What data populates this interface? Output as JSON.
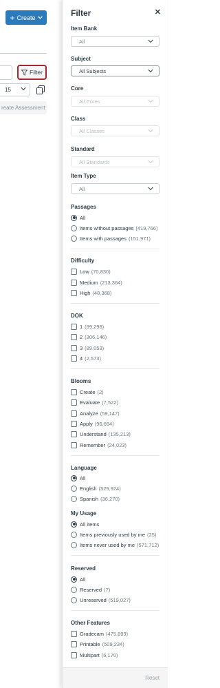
{
  "background": {
    "create_button": "Create",
    "filter_button": "Filter",
    "page_size_value": "15",
    "create_assessment": "reate Assessment"
  },
  "filter": {
    "title": "Filter",
    "item_bank": {
      "label": "Item Bank",
      "value": "All"
    },
    "subject": {
      "label": "Subject",
      "value": "All Subjects"
    },
    "core": {
      "label": "Core",
      "value": "All Cores"
    },
    "class": {
      "label": "Class",
      "value": "All Classes"
    },
    "standard": {
      "label": "Standard",
      "value": "All Standards"
    },
    "item_type": {
      "label": "Item Type",
      "value": "All"
    },
    "passages": {
      "label": "Passages",
      "options": [
        {
          "label": "All",
          "count": "",
          "selected": true
        },
        {
          "label": "Items without passages",
          "count": "(419,766)"
        },
        {
          "label": "Items with passages",
          "count": "(151,971)"
        }
      ]
    },
    "difficulty": {
      "label": "Difficulty",
      "options": [
        {
          "label": "Low",
          "count": "(70,830)"
        },
        {
          "label": "Medium",
          "count": "(213,364)"
        },
        {
          "label": "High",
          "count": "(48,368)"
        }
      ]
    },
    "dok": {
      "label": "DOK",
      "options": [
        {
          "label": "1",
          "count": "(99,298)"
        },
        {
          "label": "2",
          "count": "(306,146)"
        },
        {
          "label": "3",
          "count": "(89,053)"
        },
        {
          "label": "4",
          "count": "(2,573)"
        }
      ]
    },
    "blooms": {
      "label": "Blooms",
      "options": [
        {
          "label": "Create",
          "count": "(2)"
        },
        {
          "label": "Evaluate",
          "count": "(7,522)"
        },
        {
          "label": "Analyze",
          "count": "(59,147)"
        },
        {
          "label": "Apply",
          "count": "(96,694)"
        },
        {
          "label": "Understand",
          "count": "(135,213)"
        },
        {
          "label": "Remember",
          "count": "(24,023)"
        }
      ]
    },
    "language": {
      "label": "Language",
      "options": [
        {
          "label": "All",
          "count": "",
          "selected": true
        },
        {
          "label": "English",
          "count": "(529,924)"
        },
        {
          "label": "Spanish",
          "count": "(36,270)"
        }
      ]
    },
    "my_usage": {
      "label": "My Usage",
      "options": [
        {
          "label": "All items",
          "count": "",
          "selected": true
        },
        {
          "label": "Items previously used by me",
          "count": "(25)"
        },
        {
          "label": "Items never used by me",
          "count": "(571,712)"
        }
      ]
    },
    "reserved": {
      "label": "Reserved",
      "options": [
        {
          "label": "All",
          "count": "",
          "selected": true
        },
        {
          "label": "Reserved",
          "count": "(7)"
        },
        {
          "label": "Unreserved",
          "count": "(519,027)"
        }
      ]
    },
    "other_features": {
      "label": "Other Features",
      "options": [
        {
          "label": "Gradecam",
          "count": "(475,899)"
        },
        {
          "label": "Printable",
          "count": "(509,234)"
        },
        {
          "label": "Multipart",
          "count": "(6,170)"
        }
      ]
    },
    "reset_button": "Reset"
  },
  "colors": {
    "accent": "#2b7abc",
    "focus_border": "#a5262b",
    "text": "#2d3b45"
  }
}
